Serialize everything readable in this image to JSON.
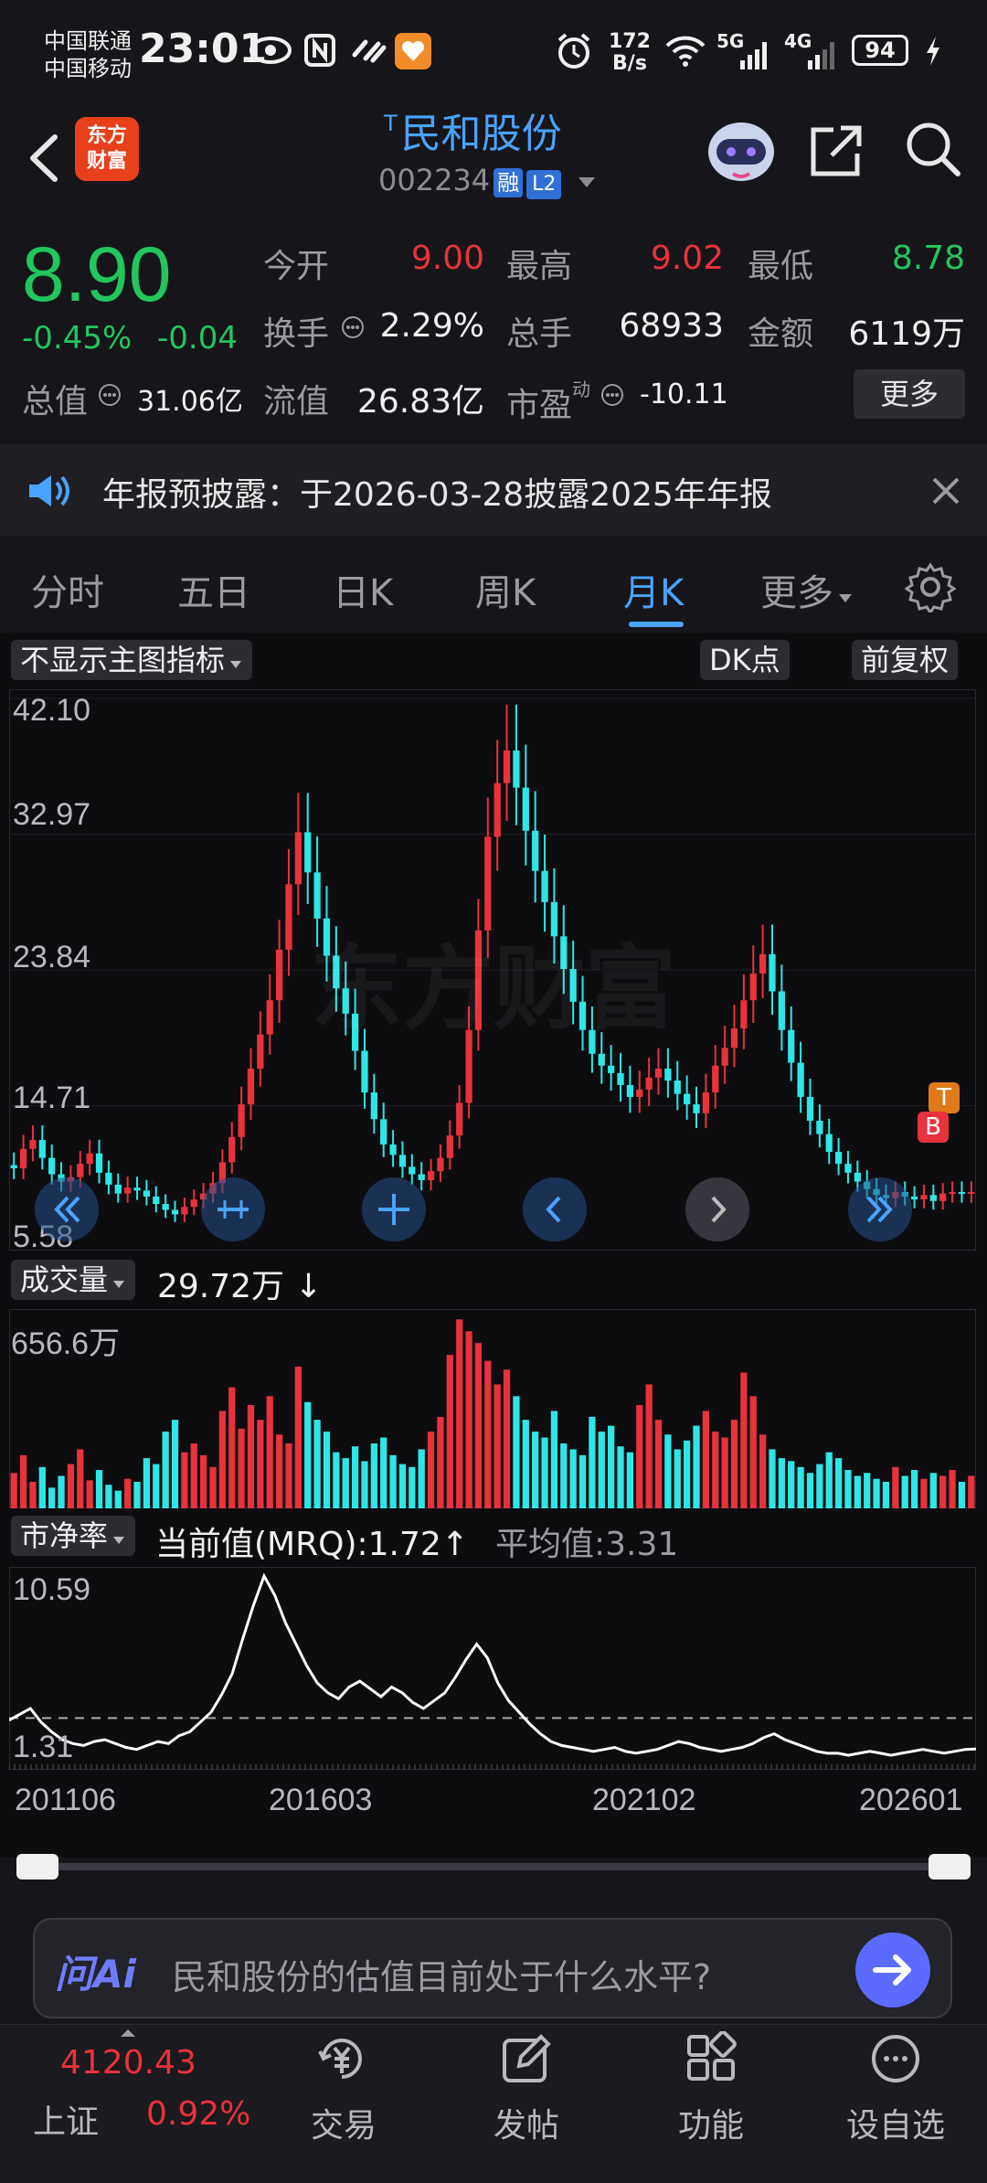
{
  "status": {
    "carrier1": "中国联通",
    "carrier2": "中国移动",
    "time": "23:01",
    "net_speed_top": "172",
    "net_speed_bottom": "B/s",
    "battery": "94"
  },
  "header": {
    "logo_line1": "东方",
    "logo_line2": "财富",
    "title_sup": "T",
    "title": "民和股份",
    "code": "002234",
    "tag1": "融",
    "tag2": "L2"
  },
  "quote": {
    "price": "8.90",
    "change_pct": "-0.45%",
    "change": "-0.04",
    "open_label": "今开",
    "open": "9.00",
    "high_label": "最高",
    "high": "9.02",
    "low_label": "最低",
    "low": "8.78",
    "turnover_label": "换手",
    "turnover": "2.29%",
    "volume_label": "总手",
    "volume": "68933",
    "amount_label": "金额",
    "amount": "6119万",
    "mcap_label": "总值",
    "mcap": "31.06亿",
    "float_label": "流值",
    "float": "26.83亿",
    "pe_label": "市盈",
    "pe_sup": "动",
    "pe": "-10.11",
    "more": "更多"
  },
  "notice": {
    "text": "年报预披露：于2026-03-28披露2025年年报"
  },
  "tabs": [
    {
      "label": "分时"
    },
    {
      "label": "五日"
    },
    {
      "label": "日K"
    },
    {
      "label": "周K"
    },
    {
      "label": "月K"
    },
    {
      "label": "更多"
    }
  ],
  "chart_controls": {
    "indicator": "不显示主图指标",
    "dk": "DK点",
    "adjust": "前复权",
    "watermark": "东方财富",
    "marker_t": "T",
    "marker_b": "B"
  },
  "volume_panel": {
    "selector": "成交量",
    "value": "29.72万 ↓",
    "max_label": "656.6万"
  },
  "pb_panel": {
    "selector": "市净率",
    "current_label": "当前值(MRQ):1.72↑",
    "avg_label": "平均值:3.31",
    "max_label": "10.59",
    "min_label": "1.31"
  },
  "x_labels": [
    "201106",
    "201603",
    "202102",
    "202601"
  ],
  "ai_bar": {
    "logo": "问Ai",
    "prompt": "民和股份的估值目前处于什么水平?"
  },
  "bottom_nav": {
    "index_value": "4120.43",
    "index_name": "上证",
    "index_change": "0.92%",
    "items": [
      {
        "label": "交易"
      },
      {
        "label": "发帖"
      },
      {
        "label": "功能"
      },
      {
        "label": "设自选"
      }
    ]
  },
  "colors": {
    "up": "#e8323c",
    "down": "#2ee6e6",
    "accent": "#4aa3ff",
    "price_down": "#22c55e"
  },
  "chart_data": [
    {
      "type": "candlestick",
      "title": "",
      "y_tick_labels": [
        "42.10",
        "32.97",
        "23.84",
        "14.71",
        "5.58"
      ],
      "ylim": [
        5.58,
        42.1
      ],
      "x_tick_labels": [
        "201106",
        "201603",
        "202102",
        "202601"
      ],
      "close_series": [
        10.5,
        11.8,
        12.4,
        11.2,
        10.1,
        9.6,
        9.9,
        10.8,
        11.5,
        10.2,
        9.4,
        8.8,
        9.2,
        9.0,
        8.6,
        8.1,
        7.7,
        7.4,
        7.9,
        8.4,
        8.8,
        9.5,
        10.9,
        12.6,
        14.8,
        17.2,
        19.5,
        21.8,
        25.2,
        29.6,
        33.1,
        30.4,
        27.3,
        24.8,
        22.6,
        20.9,
        18.4,
        15.6,
        13.8,
        12.1,
        11.4,
        10.6,
        10.1,
        9.7,
        10.3,
        11.2,
        12.7,
        14.9,
        19.8,
        26.5,
        32.8,
        36.4,
        38.6,
        36.1,
        33.2,
        30.5,
        28.4,
        26.1,
        23.9,
        21.7,
        19.8,
        18.2,
        17.4,
        16.9,
        16.1,
        15.3,
        15.8,
        16.6,
        17.2,
        16.4,
        15.5,
        14.8,
        14.2,
        15.6,
        17.4,
        18.6,
        19.9,
        21.8,
        23.6,
        24.9,
        22.4,
        19.8,
        17.6,
        15.3,
        13.7,
        12.8,
        11.6,
        10.8,
        10.2,
        9.6,
        9.1,
        8.7,
        8.5,
        8.9,
        8.6,
        8.4,
        8.7,
        8.3,
        8.8,
        8.9,
        8.8,
        8.9
      ]
    },
    {
      "type": "bar",
      "title": "",
      "series": [
        {
          "name": "成交量",
          "values": [
            120,
            180,
            90,
            140,
            70,
            110,
            150,
            200,
            95,
            130,
            80,
            60,
            100,
            90,
            170,
            150,
            260,
            300,
            190,
            220,
            180,
            140,
            330,
            410,
            270,
            350,
            300,
            380,
            250,
            220,
            480,
            360,
            300,
            260,
            190,
            170,
            210,
            160,
            220,
            240,
            180,
            150,
            140,
            200,
            260,
            310,
            520,
            640,
            600,
            560,
            500,
            420,
            470,
            380,
            300,
            260,
            240,
            330,
            220,
            200,
            180,
            310,
            260,
            280,
            210,
            190,
            350,
            420,
            300,
            250,
            200,
            230,
            280,
            330,
            260,
            240,
            300,
            460,
            380,
            250,
            200,
            170,
            160,
            140,
            120,
            150,
            190,
            170,
            130,
            110,
            120,
            100,
            90,
            140,
            110,
            130,
            100,
            120,
            110,
            130,
            90,
            110
          ]
        }
      ],
      "max_label": "656.6万"
    },
    {
      "type": "line",
      "title": "",
      "series": [
        {
          "name": "市净率",
          "values": [
            3.2,
            3.5,
            3.8,
            3.1,
            2.6,
            2.2,
            2.0,
            1.9,
            2.1,
            2.2,
            2.0,
            1.8,
            1.7,
            1.9,
            2.1,
            2.0,
            2.4,
            2.6,
            3.1,
            3.6,
            4.5,
            5.6,
            7.4,
            9.1,
            10.59,
            9.6,
            8.2,
            7.1,
            6.0,
            5.1,
            4.6,
            4.3,
            4.9,
            5.2,
            4.8,
            4.4,
            4.9,
            4.6,
            4.1,
            3.8,
            4.2,
            4.6,
            5.4,
            6.3,
            7.1,
            6.4,
            5.1,
            4.2,
            3.6,
            3.0,
            2.5,
            2.1,
            1.9,
            1.8,
            1.7,
            1.6,
            1.7,
            1.8,
            1.6,
            1.5,
            1.6,
            1.7,
            1.9,
            2.1,
            2.0,
            1.8,
            1.7,
            1.6,
            1.7,
            1.8,
            2.0,
            2.3,
            2.5,
            2.2,
            2.0,
            1.8,
            1.6,
            1.5,
            1.5,
            1.4,
            1.5,
            1.6,
            1.5,
            1.4,
            1.5,
            1.6,
            1.7,
            1.6,
            1.5,
            1.6,
            1.7,
            1.72
          ]
        }
      ],
      "ylim": [
        1.31,
        10.59
      ],
      "average": 3.31
    }
  ]
}
